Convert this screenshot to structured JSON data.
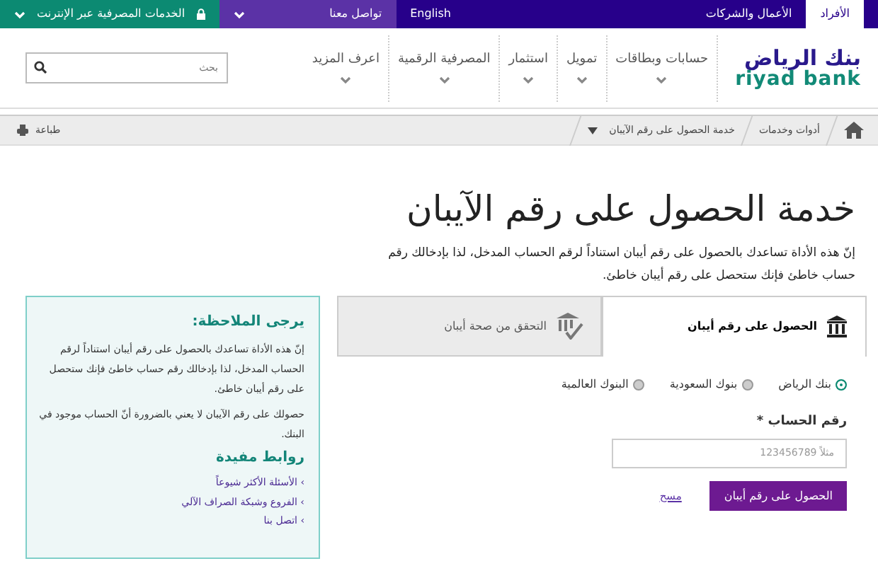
{
  "top_bar": {
    "segments": [
      {
        "label": "الأفراد",
        "selected": true
      },
      {
        "label": "الأعمال والشركات",
        "selected": false
      }
    ],
    "language": "English",
    "contact": "تواصل معنا",
    "online_banking": "الخدمات المصرفية عبر الإنترنت"
  },
  "logo": {
    "arabic": "بنك الرياض",
    "latin": "riyad bank"
  },
  "nav": [
    "حسابات وبطاقات",
    "تمويل",
    "استثمار",
    "المصرفية الرقمية",
    "اعرف المزيد"
  ],
  "search": {
    "placeholder": "بحث"
  },
  "breadcrumb": [
    "أدوات وخدمات",
    "خدمة الحصول على رقم الآيبان"
  ],
  "print": "طباعة",
  "title": "خدمة الحصول على رقم الآيبان",
  "intro": "إنّ هذه الأداة تساعدك بالحصول على رقم أيبان استناداً لرقم الحساب المدخل، لذا بإدخالك رقم حساب خاطئ فإنك ستحصل على رقم أيبان خاطئ.",
  "tabs": [
    {
      "label": "الحصول على رقم أيبان",
      "selected": true
    },
    {
      "label": "التحقق من صحة أيبان",
      "selected": false
    }
  ],
  "radios": [
    {
      "label": "بنك الرياض",
      "selected": true
    },
    {
      "label": "بنوك السعودية",
      "selected": false
    },
    {
      "label": "البنوك العالمية",
      "selected": false
    }
  ],
  "account_field": {
    "label": "رقم الحساب",
    "required_mark": "*",
    "placeholder": "مثلاً 123456789"
  },
  "submit": "الحصول على رقم أيبان",
  "reset": "مسح",
  "sidebar": {
    "note_title": "يرجى الملاحظة:",
    "paragraphs": [
      "إنّ هذه الأداة تساعدك بالحصول على رقم أيبان استناداً لرقم الحساب المدخل، لذا بإدخالك رقم حساب خاطئ فإنك ستحصل على رقم أيبان خاطئ.",
      "حصولك على رقم الآيبان لا يعني بالضرورة أنّ الحساب موجود في البنك."
    ],
    "links_title": "روابط مفيدة",
    "links": [
      {
        "marker": "›",
        "label": "الأسئلة الأكثر شيوعاً"
      },
      {
        "marker": "›",
        "label": "الفروع وشبكة الصراف الآلي"
      },
      {
        "marker": "›",
        "label": "اتصل بنا"
      }
    ]
  }
}
